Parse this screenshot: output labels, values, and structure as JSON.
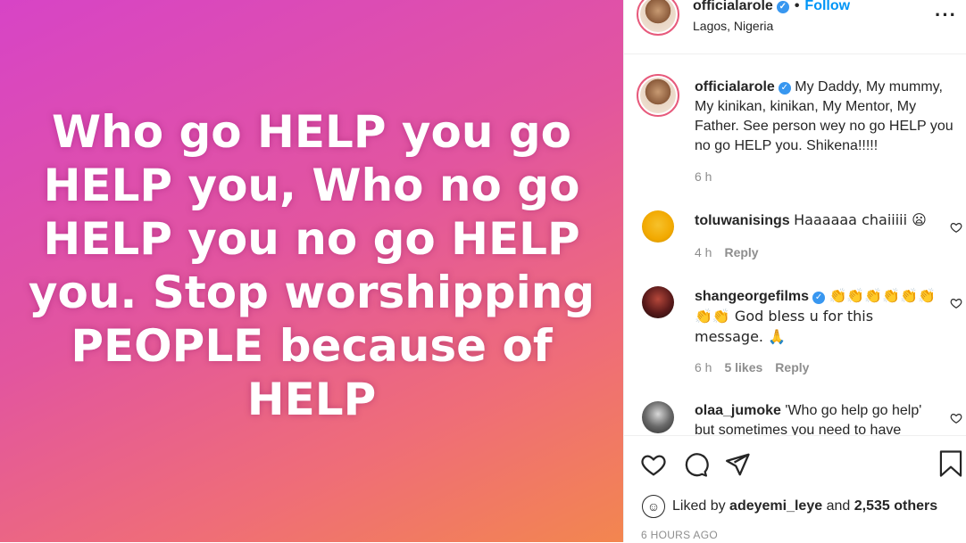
{
  "media": {
    "text": "Who go HELP you go HELP you, Who no go HELP you no go HELP you. Stop worshipping PEOPLE because of HELP"
  },
  "header": {
    "username": "officialarole",
    "separator": "•",
    "follow_label": "Follow",
    "location": "Lagos, Nigeria",
    "more_icon": "more-options-icon"
  },
  "caption": {
    "username": "officialarole",
    "text": "My Daddy, My mummy, My kinikan, kinikan, My Mentor, My Father. See person wey no go HELP you no go HELP you. Shikena!!!!!",
    "time": "6 h"
  },
  "comments": [
    {
      "username": "toluwanisings",
      "text": "Haaaaaa chaiiiii 😦",
      "time": "4 h",
      "likes": "",
      "reply": "Reply"
    },
    {
      "username": "shangeorgefilms",
      "text": "👏👏👏👏👏👏👏👏 God bless u for this message. 🙏",
      "time": "6 h",
      "likes": "5 likes",
      "reply": "Reply"
    },
    {
      "username": "olaa_jumoke",
      "text": "'Who go help go help' but sometimes you need to have",
      "time": "",
      "likes": "",
      "reply": ""
    }
  ],
  "actions": {
    "icons": [
      "heart-icon",
      "comment-icon",
      "share-icon",
      "bookmark-icon"
    ]
  },
  "likes": {
    "prefix": "Liked by",
    "user": "adeyemi_leye",
    "middle": "and",
    "others": "2,535 others"
  },
  "time_ago": "6 HOURS AGO",
  "colors": {
    "gradient_start": "#d744c6",
    "gradient_end": "#f3864f",
    "follow": "#0095f6",
    "verified": "#3897f0",
    "muted": "#8e8e8e"
  }
}
